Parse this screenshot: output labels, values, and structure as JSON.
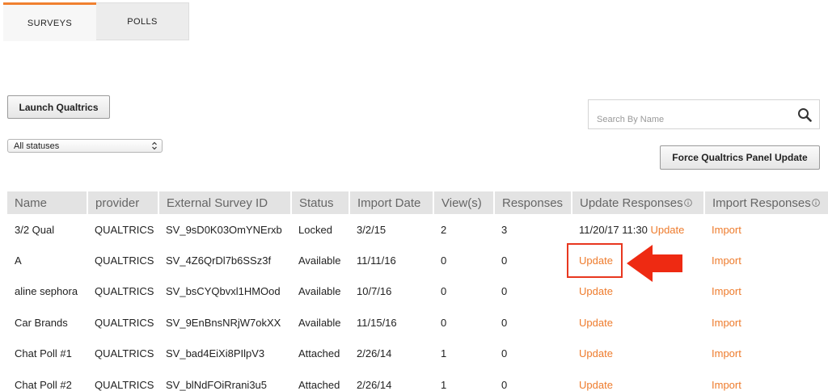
{
  "tabs": [
    {
      "label": "SURVEYS",
      "active": true
    },
    {
      "label": "POLLS",
      "active": false
    }
  ],
  "toolbar": {
    "launch_label": "Launch Qualtrics",
    "force_update_label": "Force Qualtrics Panel Update"
  },
  "filter": {
    "status_selected": "All statuses"
  },
  "search": {
    "placeholder": "Search By Name",
    "icon": "search-icon"
  },
  "table": {
    "columns": [
      "Name",
      "provider",
      "External Survey ID",
      "Status",
      "Import Date",
      "View(s)",
      "Responses",
      "Update Responses",
      "Import Responses"
    ],
    "info_columns": [
      "Update Responses",
      "Import Responses"
    ],
    "rows": [
      {
        "name": "3/2 Qual",
        "provider": "QUALTRICS",
        "external_id": "SV_9sD0K03OmYNErxb",
        "status": "Locked",
        "import_date": "3/2/15",
        "views": "2",
        "responses": "3",
        "update_timestamp": "11/20/17 11:30",
        "update_label": "Update",
        "import_label": "Import"
      },
      {
        "name": "A",
        "provider": "QUALTRICS",
        "external_id": "SV_4Z6QrDl7b6SSz3f",
        "status": "Available",
        "import_date": "11/11/16",
        "views": "0",
        "responses": "0",
        "update_timestamp": "",
        "update_label": "Update",
        "import_label": "Import"
      },
      {
        "name": "aline sephora",
        "provider": "QUALTRICS",
        "external_id": "SV_bsCYQbvxl1HMOod",
        "status": "Available",
        "import_date": "10/7/16",
        "views": "0",
        "responses": "0",
        "update_timestamp": "",
        "update_label": "Update",
        "import_label": "Import"
      },
      {
        "name": "Car Brands",
        "provider": "QUALTRICS",
        "external_id": "SV_9EnBnsNRjW7okXX",
        "status": "Available",
        "import_date": "11/15/16",
        "views": "0",
        "responses": "0",
        "update_timestamp": "",
        "update_label": "Update",
        "import_label": "Import"
      },
      {
        "name": "Chat Poll #1",
        "provider": "QUALTRICS",
        "external_id": "SV_bad4EiXi8PIlpV3",
        "status": "Attached",
        "import_date": "2/26/14",
        "views": "1",
        "responses": "0",
        "update_timestamp": "",
        "update_label": "Update",
        "import_label": "Import"
      },
      {
        "name": "Chat Poll #2",
        "provider": "QUALTRICS",
        "external_id": "SV_blNdFOiRrani3u5",
        "status": "Attached",
        "import_date": "2/26/14",
        "views": "1",
        "responses": "0",
        "update_timestamp": "",
        "update_label": "Update",
        "import_label": "Import"
      }
    ]
  },
  "colors": {
    "accent": "#ee7b2c",
    "annotation": "#e8371f",
    "header_bg": "#e3e3e3"
  },
  "annotations": {
    "highlight_icon": "highlight-box",
    "arrow_icon": "red-arrow-icon"
  }
}
